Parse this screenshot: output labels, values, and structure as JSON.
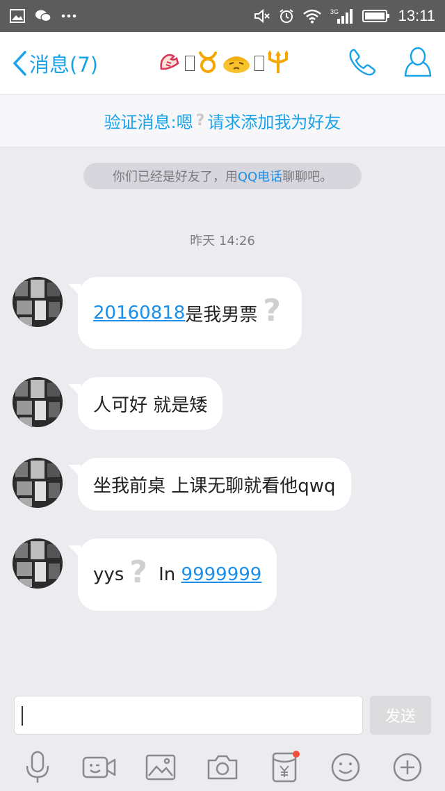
{
  "status_bar": {
    "time": "13:11",
    "left_icons": [
      "gallery-notification-icon",
      "wechat-notification-icon",
      "more-dots-icon"
    ],
    "right_icons": [
      "mute-icon",
      "alarm-icon",
      "wifi-icon",
      "signal-3g-icon",
      "battery-icon"
    ],
    "network_label": "3G"
  },
  "header": {
    "back_label": "消息(7)",
    "contact_name_icons": [
      "emoji-flexed-arm-icon",
      "missing-glyph-icon",
      "taurus-icon",
      "emoji-shy-face-icon",
      "missing-glyph-icon",
      "trident-icon"
    ],
    "actions": [
      "phone-icon",
      "profile-icon"
    ]
  },
  "verification": {
    "prefix": "验证消息:嗯",
    "question": "?",
    "suffix": "请求添加我为好友"
  },
  "notice": {
    "before": "你们已经是好友了，用",
    "link": "QQ电话",
    "after": "聊聊吧。"
  },
  "timestamp": "昨天 14:26",
  "messages": [
    {
      "link": "20160818",
      "text": "是我男票",
      "question": "?"
    },
    {
      "text": "人可好 就是矮"
    },
    {
      "text": "坐我前桌 上课无聊就看他qwq"
    },
    {
      "prefix": "yys",
      "question": "?",
      "mid": " In ",
      "link": "9999999"
    }
  ],
  "composer": {
    "input_value": "",
    "send_label": "发送"
  },
  "toolbar": {
    "items": [
      "microphone-icon",
      "video-call-icon",
      "photo-icon",
      "camera-icon",
      "red-packet-icon",
      "emoji-icon",
      "plus-icon"
    ],
    "badge_color": "#f2503b"
  },
  "colors": {
    "accent": "#1aa3e8",
    "link": "#1a8ee8",
    "chat_background": "#ebebf0"
  }
}
